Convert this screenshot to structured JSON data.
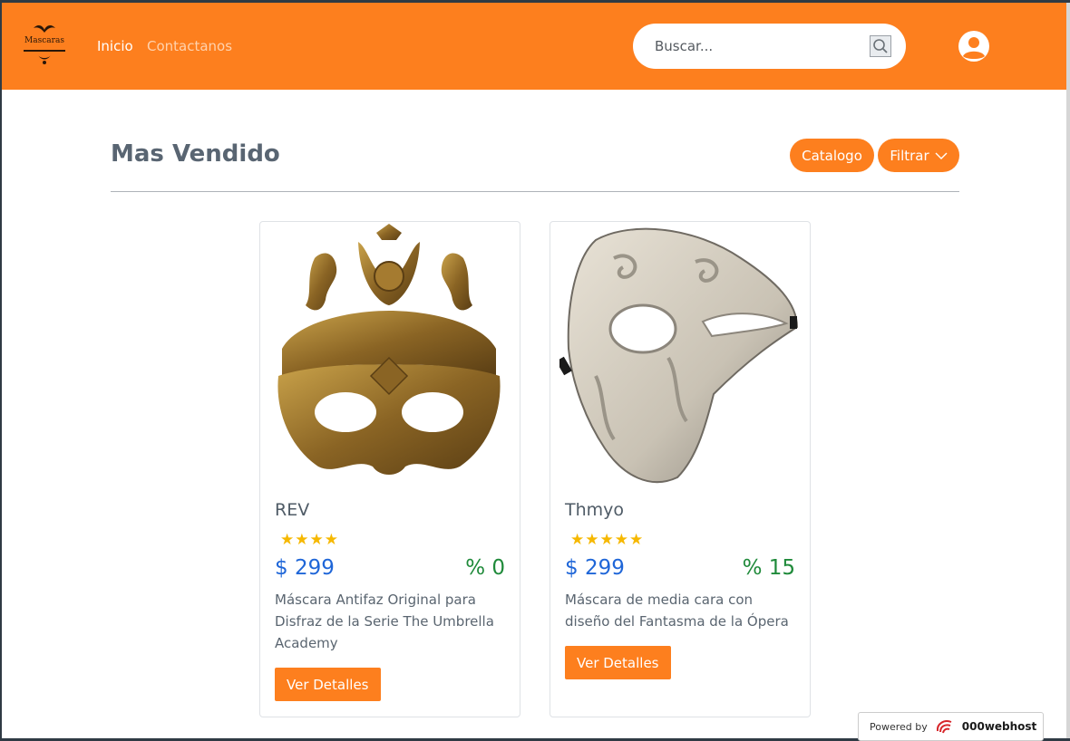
{
  "header": {
    "logo_text": "Mascaras",
    "nav": [
      {
        "label": "Inicio"
      },
      {
        "label": "Contactanos"
      }
    ],
    "search": {
      "placeholder": "Buscar..."
    }
  },
  "main": {
    "title": "Mas Vendido",
    "catalogo_label": "Catalogo",
    "filtrar_label": "Filtrar",
    "products": [
      {
        "name": "REV",
        "stars": "★★★★",
        "rating": 4,
        "price": "$ 299",
        "discount": "% 0",
        "description": "Máscara Antifaz Original para Disfraz de la Serie The Umbrella Academy",
        "button": "Ver Detalles"
      },
      {
        "name": "Thmyo",
        "stars": "★★★★★",
        "rating": 5,
        "price": "$ 299",
        "discount": "% 15",
        "description": "Máscara de media cara con diseño del Fantasma de la Ópera",
        "button": "Ver Detalles"
      }
    ]
  },
  "footer": {
    "powered_label": "Powered by",
    "powered_brand": "000webhost"
  },
  "colors": {
    "brand": "#fd7f1e",
    "price": "#1f66d8",
    "discount": "#1f8a3a",
    "stars": "#f6b800"
  },
  "icons": [
    "search-icon",
    "user-icon",
    "chevron-down-icon",
    "star-icon"
  ]
}
